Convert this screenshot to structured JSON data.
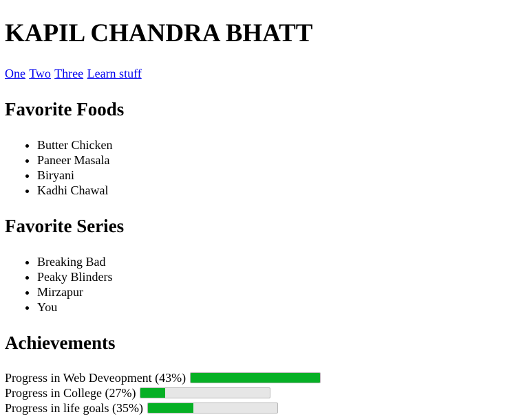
{
  "header": {
    "title": "KAPIL CHANDRA BHATT"
  },
  "nav": {
    "links": [
      "One",
      "Two",
      "Three",
      "Learn stuff"
    ]
  },
  "foods": {
    "heading": "Favorite Foods",
    "items": [
      "Butter Chicken",
      "Paneer Masala",
      "Biryani",
      "Kadhi Chawal"
    ]
  },
  "series": {
    "heading": "Favorite Series",
    "items": [
      "Breaking Bad",
      "Peaky Blinders",
      "Mirzapur",
      "You"
    ]
  },
  "achievements": {
    "heading": "Achievements",
    "progress": [
      {
        "label": "Progress in Web Deveopment (43%)",
        "value": 1.0
      },
      {
        "label": "Progress in College (27%)",
        "value": 0.19
      },
      {
        "label": "Progress in life goals (35%)",
        "value": 0.35
      }
    ]
  },
  "colors": {
    "link": "#0000ee",
    "progress_fill": "#06b025",
    "progress_track": "#e6e6e6"
  }
}
